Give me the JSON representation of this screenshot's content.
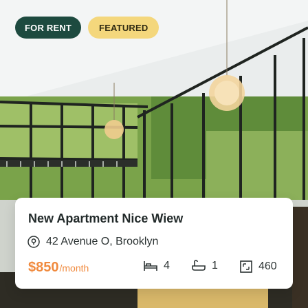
{
  "badges": {
    "for_rent": "FOR RENT",
    "featured": "FEATURED"
  },
  "listing": {
    "title": "New Apartment Nice Wiew",
    "address": "42 Avenue O, Brooklyn",
    "price": "$850",
    "price_unit": "/month",
    "bedrooms": "4",
    "bathrooms": "1",
    "area": "460"
  },
  "icons": {
    "location": "location-pin-icon",
    "bed": "bed-icon",
    "bath": "bathtub-icon",
    "area": "area-icon"
  },
  "colors": {
    "for_rent_bg": "#1d4a3f",
    "featured_bg": "#f4d77c",
    "price": "#f08a3e"
  }
}
